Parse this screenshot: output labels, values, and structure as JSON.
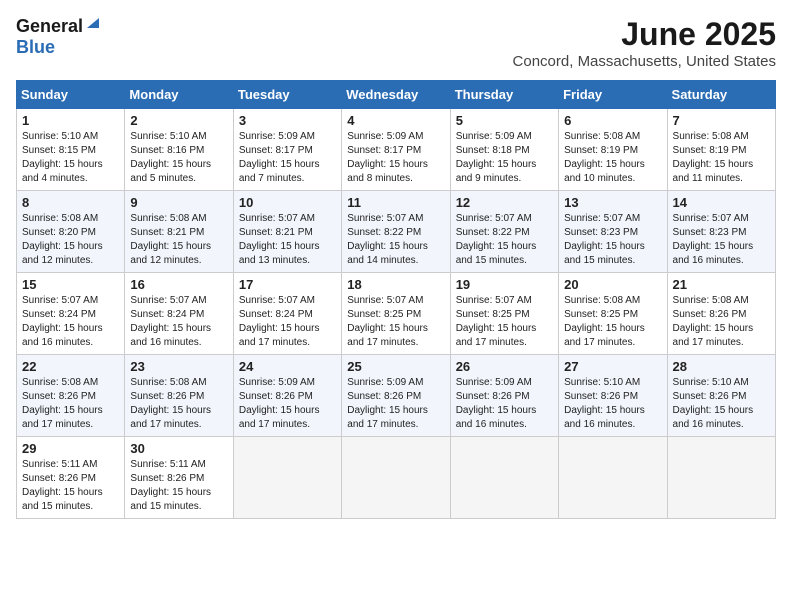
{
  "header": {
    "logo_general": "General",
    "logo_blue": "Blue",
    "title": "June 2025",
    "subtitle": "Concord, Massachusetts, United States"
  },
  "calendar": {
    "days_of_week": [
      "Sunday",
      "Monday",
      "Tuesday",
      "Wednesday",
      "Thursday",
      "Friday",
      "Saturday"
    ],
    "weeks": [
      [
        {
          "day": "1",
          "sunrise": "5:10 AM",
          "sunset": "8:15 PM",
          "daylight": "15 hours and 4 minutes."
        },
        {
          "day": "2",
          "sunrise": "5:10 AM",
          "sunset": "8:16 PM",
          "daylight": "15 hours and 5 minutes."
        },
        {
          "day": "3",
          "sunrise": "5:09 AM",
          "sunset": "8:17 PM",
          "daylight": "15 hours and 7 minutes."
        },
        {
          "day": "4",
          "sunrise": "5:09 AM",
          "sunset": "8:17 PM",
          "daylight": "15 hours and 8 minutes."
        },
        {
          "day": "5",
          "sunrise": "5:09 AM",
          "sunset": "8:18 PM",
          "daylight": "15 hours and 9 minutes."
        },
        {
          "day": "6",
          "sunrise": "5:08 AM",
          "sunset": "8:19 PM",
          "daylight": "15 hours and 10 minutes."
        },
        {
          "day": "7",
          "sunrise": "5:08 AM",
          "sunset": "8:19 PM",
          "daylight": "15 hours and 11 minutes."
        }
      ],
      [
        {
          "day": "8",
          "sunrise": "5:08 AM",
          "sunset": "8:20 PM",
          "daylight": "15 hours and 12 minutes."
        },
        {
          "day": "9",
          "sunrise": "5:08 AM",
          "sunset": "8:21 PM",
          "daylight": "15 hours and 12 minutes."
        },
        {
          "day": "10",
          "sunrise": "5:07 AM",
          "sunset": "8:21 PM",
          "daylight": "15 hours and 13 minutes."
        },
        {
          "day": "11",
          "sunrise": "5:07 AM",
          "sunset": "8:22 PM",
          "daylight": "15 hours and 14 minutes."
        },
        {
          "day": "12",
          "sunrise": "5:07 AM",
          "sunset": "8:22 PM",
          "daylight": "15 hours and 15 minutes."
        },
        {
          "day": "13",
          "sunrise": "5:07 AM",
          "sunset": "8:23 PM",
          "daylight": "15 hours and 15 minutes."
        },
        {
          "day": "14",
          "sunrise": "5:07 AM",
          "sunset": "8:23 PM",
          "daylight": "15 hours and 16 minutes."
        }
      ],
      [
        {
          "day": "15",
          "sunrise": "5:07 AM",
          "sunset": "8:24 PM",
          "daylight": "15 hours and 16 minutes."
        },
        {
          "day": "16",
          "sunrise": "5:07 AM",
          "sunset": "8:24 PM",
          "daylight": "15 hours and 16 minutes."
        },
        {
          "day": "17",
          "sunrise": "5:07 AM",
          "sunset": "8:24 PM",
          "daylight": "15 hours and 17 minutes."
        },
        {
          "day": "18",
          "sunrise": "5:07 AM",
          "sunset": "8:25 PM",
          "daylight": "15 hours and 17 minutes."
        },
        {
          "day": "19",
          "sunrise": "5:07 AM",
          "sunset": "8:25 PM",
          "daylight": "15 hours and 17 minutes."
        },
        {
          "day": "20",
          "sunrise": "5:08 AM",
          "sunset": "8:25 PM",
          "daylight": "15 hours and 17 minutes."
        },
        {
          "day": "21",
          "sunrise": "5:08 AM",
          "sunset": "8:26 PM",
          "daylight": "15 hours and 17 minutes."
        }
      ],
      [
        {
          "day": "22",
          "sunrise": "5:08 AM",
          "sunset": "8:26 PM",
          "daylight": "15 hours and 17 minutes."
        },
        {
          "day": "23",
          "sunrise": "5:08 AM",
          "sunset": "8:26 PM",
          "daylight": "15 hours and 17 minutes."
        },
        {
          "day": "24",
          "sunrise": "5:09 AM",
          "sunset": "8:26 PM",
          "daylight": "15 hours and 17 minutes."
        },
        {
          "day": "25",
          "sunrise": "5:09 AM",
          "sunset": "8:26 PM",
          "daylight": "15 hours and 17 minutes."
        },
        {
          "day": "26",
          "sunrise": "5:09 AM",
          "sunset": "8:26 PM",
          "daylight": "15 hours and 16 minutes."
        },
        {
          "day": "27",
          "sunrise": "5:10 AM",
          "sunset": "8:26 PM",
          "daylight": "15 hours and 16 minutes."
        },
        {
          "day": "28",
          "sunrise": "5:10 AM",
          "sunset": "8:26 PM",
          "daylight": "15 hours and 16 minutes."
        }
      ],
      [
        {
          "day": "29",
          "sunrise": "5:11 AM",
          "sunset": "8:26 PM",
          "daylight": "15 hours and 15 minutes."
        },
        {
          "day": "30",
          "sunrise": "5:11 AM",
          "sunset": "8:26 PM",
          "daylight": "15 hours and 15 minutes."
        },
        null,
        null,
        null,
        null,
        null
      ]
    ]
  }
}
